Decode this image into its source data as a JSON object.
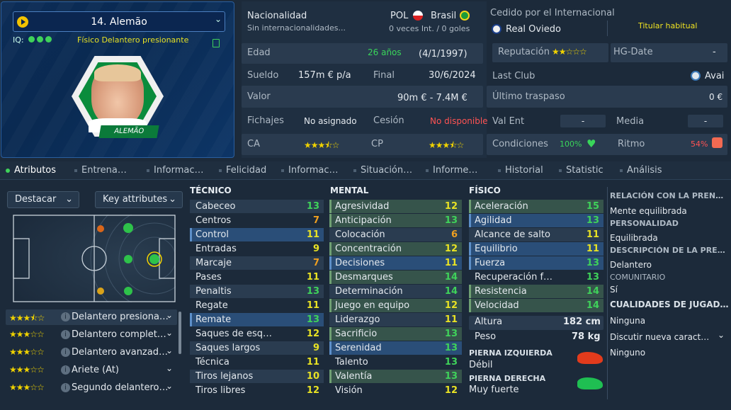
{
  "player": {
    "name": "14. Alemão",
    "iq_label": "IQ:",
    "role": "Físico  Delantero presionante",
    "shirt_name": "ALEMÃO"
  },
  "info": {
    "nat_label": "Nacionalidad",
    "nat_codes": "POL",
    "nat_country": "Brasil",
    "intl": "Sin internacionalidades...",
    "intl_stats": "0 veces Int. / 0 goles",
    "loan_label": "Cedido por el Internacional",
    "loan_club": "Real Oviedo",
    "loan_status": "Titular habitual",
    "age_label": "Edad",
    "age": "26 años",
    "dob": "(4/1/1997)",
    "rep_label": "Reputación",
    "hg_label": "HG-Date",
    "hg_value": "-",
    "wage_label": "Sueldo",
    "wage": "157m € p/a",
    "end_label": "Final",
    "end": "30/6/2024",
    "last_club_label": "Last Club",
    "last_club": "Avai",
    "value_label": "Valor",
    "value": "90m € - 7.4M €",
    "last_transfer_label": "Último traspaso",
    "last_transfer": "0 €",
    "sign_label": "Fichajes",
    "sign": "No asignado",
    "loan_out_label": "Cesión",
    "loan_out": "No disponible",
    "valent_label": "Val Ent",
    "valent": "-",
    "media_label": "Media",
    "media": "-",
    "ca_label": "CA",
    "cp_label": "CP",
    "cond_label": "Condiciones",
    "cond": "100%",
    "ritmo_label": "Ritmo",
    "ritmo": "54%",
    "stars_rep": "★★☆☆☆",
    "stars_ca": "★★★⯪☆",
    "stars_cp": "★★★⯪☆"
  },
  "tabs": [
    "Atributos",
    "Entrena…",
    "Informac…",
    "Felicidad",
    "Informac…",
    "Situación…",
    "Informe…",
    "Historial",
    "Statistic",
    "Análisis"
  ],
  "controls": {
    "highlight": "Destacar",
    "key": "Key attributes"
  },
  "roles": [
    {
      "stars": "★★★⯪☆",
      "name": "Delantero presiona…"
    },
    {
      "stars": "★★★☆☆",
      "name": "Delantero complet…"
    },
    {
      "stars": "★★★☆☆",
      "name": "Delantero avanzad…"
    },
    {
      "stars": "★★★☆☆",
      "name": "Ariete (At)"
    },
    {
      "stars": "★★★☆☆",
      "name": "Segundo delantero…"
    }
  ],
  "technical": {
    "title": "TÉCNICO",
    "items": [
      {
        "n": "Cabeceo",
        "v": "13"
      },
      {
        "n": "Centros",
        "v": "7"
      },
      {
        "n": "Control",
        "v": "11"
      },
      {
        "n": "Entradas",
        "v": "9"
      },
      {
        "n": "Marcaje",
        "v": "7"
      },
      {
        "n": "Pases",
        "v": "11"
      },
      {
        "n": "Penaltis",
        "v": "13"
      },
      {
        "n": "Regate",
        "v": "11"
      },
      {
        "n": "Remate",
        "v": "13"
      },
      {
        "n": "Saques de esq…",
        "v": "12"
      },
      {
        "n": "Saques largos",
        "v": "9"
      },
      {
        "n": "Técnica",
        "v": "11"
      },
      {
        "n": "Tiros lejanos",
        "v": "10"
      },
      {
        "n": "Tiros libres",
        "v": "12"
      }
    ]
  },
  "mental": {
    "title": "MENTAL",
    "items": [
      {
        "n": "Agresividad",
        "v": "12"
      },
      {
        "n": "Anticipación",
        "v": "13"
      },
      {
        "n": "Colocación",
        "v": "6"
      },
      {
        "n": "Concentración",
        "v": "12"
      },
      {
        "n": "Decisiones",
        "v": "11"
      },
      {
        "n": "Desmarques",
        "v": "14"
      },
      {
        "n": "Determinación",
        "v": "14"
      },
      {
        "n": "Juego en equipo",
        "v": "12"
      },
      {
        "n": "Liderazgo",
        "v": "11"
      },
      {
        "n": "Sacrificio",
        "v": "13"
      },
      {
        "n": "Serenidad",
        "v": "13"
      },
      {
        "n": "Talento",
        "v": "13"
      },
      {
        "n": "Valentía",
        "v": "13"
      },
      {
        "n": "Visión",
        "v": "12"
      }
    ]
  },
  "physical": {
    "title": "FÍSICO",
    "items": [
      {
        "n": "Aceleración",
        "v": "15"
      },
      {
        "n": "Agilidad",
        "v": "13"
      },
      {
        "n": "Alcance de salto",
        "v": "11"
      },
      {
        "n": "Equilibrio",
        "v": "11"
      },
      {
        "n": "Fuerza",
        "v": "13"
      },
      {
        "n": "Recuperación f…",
        "v": "13"
      },
      {
        "n": "Resistencia",
        "v": "14"
      },
      {
        "n": "Velocidad",
        "v": "14"
      }
    ],
    "height_label": "Altura",
    "height": "182 cm",
    "weight_label": "Peso",
    "weight": "78 kg",
    "left_foot_label": "PIERNA IZQUIERDA",
    "left_foot": "Débil",
    "right_foot_label": "PIERNA DERECHA",
    "right_foot": "Muy fuerte"
  },
  "side": {
    "rel_label": "RELACIÓN CON LA PREN…",
    "rel": "Mente equilibrada",
    "pers_label": "PERSONALIDAD",
    "pers": "Equilibrada",
    "desc_label": "DESCRIPCIÓN DE LA PRE…",
    "desc": "Delantero",
    "comm_label": "COMUNITARIO",
    "comm": "Sí",
    "qual_label": "CUALIDADES DE JUGAD…",
    "qual": "Ninguna",
    "discuss": "Discutir nueva caract…",
    "discuss_val": "Ninguno"
  }
}
